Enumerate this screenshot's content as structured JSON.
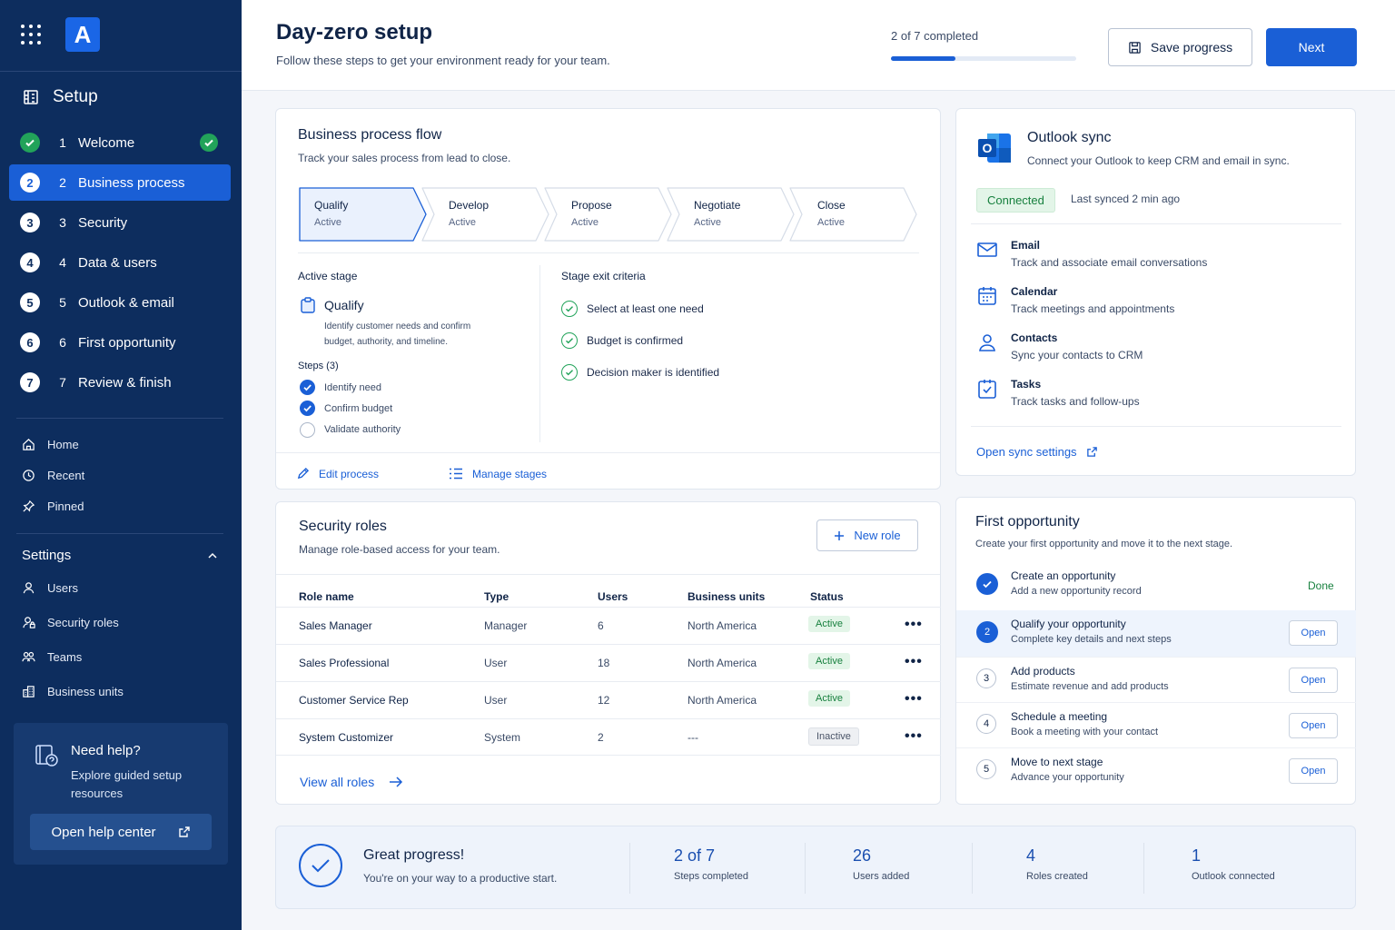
{
  "app": {
    "logo_letter": "A"
  },
  "sidebar": {
    "title": "Setup",
    "steps": [
      {
        "num": "1",
        "label": "Welcome",
        "state": "done"
      },
      {
        "num": "2",
        "label": "Business process",
        "state": "active"
      },
      {
        "num": "3",
        "label": "Security",
        "state": "todo"
      },
      {
        "num": "4",
        "label": "Data & users",
        "state": "todo"
      },
      {
        "num": "5",
        "label": "Outlook & email",
        "state": "todo"
      },
      {
        "num": "6",
        "label": "First opportunity",
        "state": "todo"
      },
      {
        "num": "7",
        "label": "Review & finish",
        "state": "todo"
      }
    ],
    "nav": [
      {
        "label": "Home",
        "icon": "home-icon"
      },
      {
        "label": "Recent",
        "icon": "clock-icon"
      },
      {
        "label": "Pinned",
        "icon": "pin-icon"
      }
    ],
    "settings_title": "Settings",
    "settings": [
      {
        "label": "Users",
        "icon": "user-icon"
      },
      {
        "label": "Security roles",
        "icon": "user-lock-icon"
      },
      {
        "label": "Teams",
        "icon": "people-icon"
      },
      {
        "label": "Business units",
        "icon": "building-icon"
      }
    ],
    "help": {
      "title": "Need help?",
      "desc_line1": "Explore guided setup",
      "desc_line2": "resources",
      "button": "Open help center"
    }
  },
  "header": {
    "title": "Day-zero setup",
    "subtitle": "Follow these steps to get your environment ready for your team.",
    "progress_text": "2 of 7 completed",
    "progress_fraction": 0.35,
    "save_label": "Save progress",
    "next_label": "Next"
  },
  "process": {
    "title": "Business process flow",
    "subtitle": "Track your sales process from lead to close.",
    "stages": [
      {
        "name": "Qualify",
        "status": "Active"
      },
      {
        "name": "Develop",
        "status": "Active"
      },
      {
        "name": "Propose",
        "status": "Active"
      },
      {
        "name": "Negotiate",
        "status": "Active"
      },
      {
        "name": "Close",
        "status": "Active"
      }
    ],
    "active_stage_label": "Active stage",
    "active_stage_name": "Qualify",
    "active_stage_desc_line1": "Identify customer needs and confirm",
    "active_stage_desc_line2": "budget, authority, and timeline.",
    "steps_label": "Steps (3)",
    "steps": [
      {
        "label": "Identify need",
        "checked": true
      },
      {
        "label": "Confirm budget",
        "checked": true
      },
      {
        "label": "Validate authority",
        "checked": false
      }
    ],
    "criteria_label": "Stage exit criteria",
    "criteria": [
      "Select at least one need",
      "Budget is confirmed",
      "Decision maker is identified"
    ],
    "edit_label": "Edit process",
    "manage_label": "Manage stages"
  },
  "security": {
    "title": "Security roles",
    "subtitle": "Manage role-based access for your team.",
    "new_role_label": "New role",
    "columns": [
      "Role name",
      "Type",
      "Users",
      "Business units",
      "Status"
    ],
    "rows": [
      {
        "name": "Sales Manager",
        "type": "Manager",
        "users": "6",
        "unit": "North America",
        "status": "Active"
      },
      {
        "name": "Sales Professional",
        "type": "User",
        "users": "18",
        "unit": "North America",
        "status": "Active"
      },
      {
        "name": "Customer Service Rep",
        "type": "User",
        "users": "12",
        "unit": "North America",
        "status": "Active"
      },
      {
        "name": "System Customizer",
        "type": "System",
        "users": "2",
        "unit": "---",
        "status": "Inactive"
      }
    ],
    "view_all_label": "View all roles"
  },
  "outlook": {
    "title": "Outlook sync",
    "subtitle": "Connect your Outlook to keep CRM and email in sync.",
    "status": "Connected",
    "last_synced": "Last synced 2 min ago",
    "features": [
      {
        "title": "Email",
        "desc": "Track and associate email conversations",
        "icon": "mail-icon"
      },
      {
        "title": "Calendar",
        "desc": "Track meetings and appointments",
        "icon": "calendar-icon"
      },
      {
        "title": "Contacts",
        "desc": "Sync your contacts to CRM",
        "icon": "contact-icon"
      },
      {
        "title": "Tasks",
        "desc": "Track tasks and follow-ups",
        "icon": "task-icon"
      }
    ],
    "settings_link": "Open sync settings"
  },
  "opportunity": {
    "title": "First opportunity",
    "subtitle": "Create your first opportunity and move it to the next stage.",
    "items": [
      {
        "num": "1",
        "title": "Create an opportunity",
        "desc": "Add a new opportunity record",
        "state": "done",
        "action": "Done"
      },
      {
        "num": "2",
        "title": "Qualify your opportunity",
        "desc": "Complete key details and next steps",
        "state": "active",
        "action": "Open"
      },
      {
        "num": "3",
        "title": "Add products",
        "desc": "Estimate revenue and add products",
        "state": "todo",
        "action": "Open"
      },
      {
        "num": "4",
        "title": "Schedule a meeting",
        "desc": "Book a meeting with your contact",
        "state": "todo",
        "action": "Open"
      },
      {
        "num": "5",
        "title": "Move to next stage",
        "desc": "Advance your opportunity",
        "state": "todo",
        "action": "Open"
      }
    ]
  },
  "summary": {
    "title": "Great progress!",
    "subtitle": "You're on your way to a productive start.",
    "stats": [
      {
        "value": "2 of 7",
        "label": "Steps completed"
      },
      {
        "value": "26",
        "label": "Users added"
      },
      {
        "value": "4",
        "label": "Roles created"
      },
      {
        "value": "1",
        "label": "Outlook connected"
      }
    ]
  },
  "colors": {
    "accent": "#1a5fd6",
    "sidebar": "#0d2d5e",
    "success": "#22a35a"
  }
}
